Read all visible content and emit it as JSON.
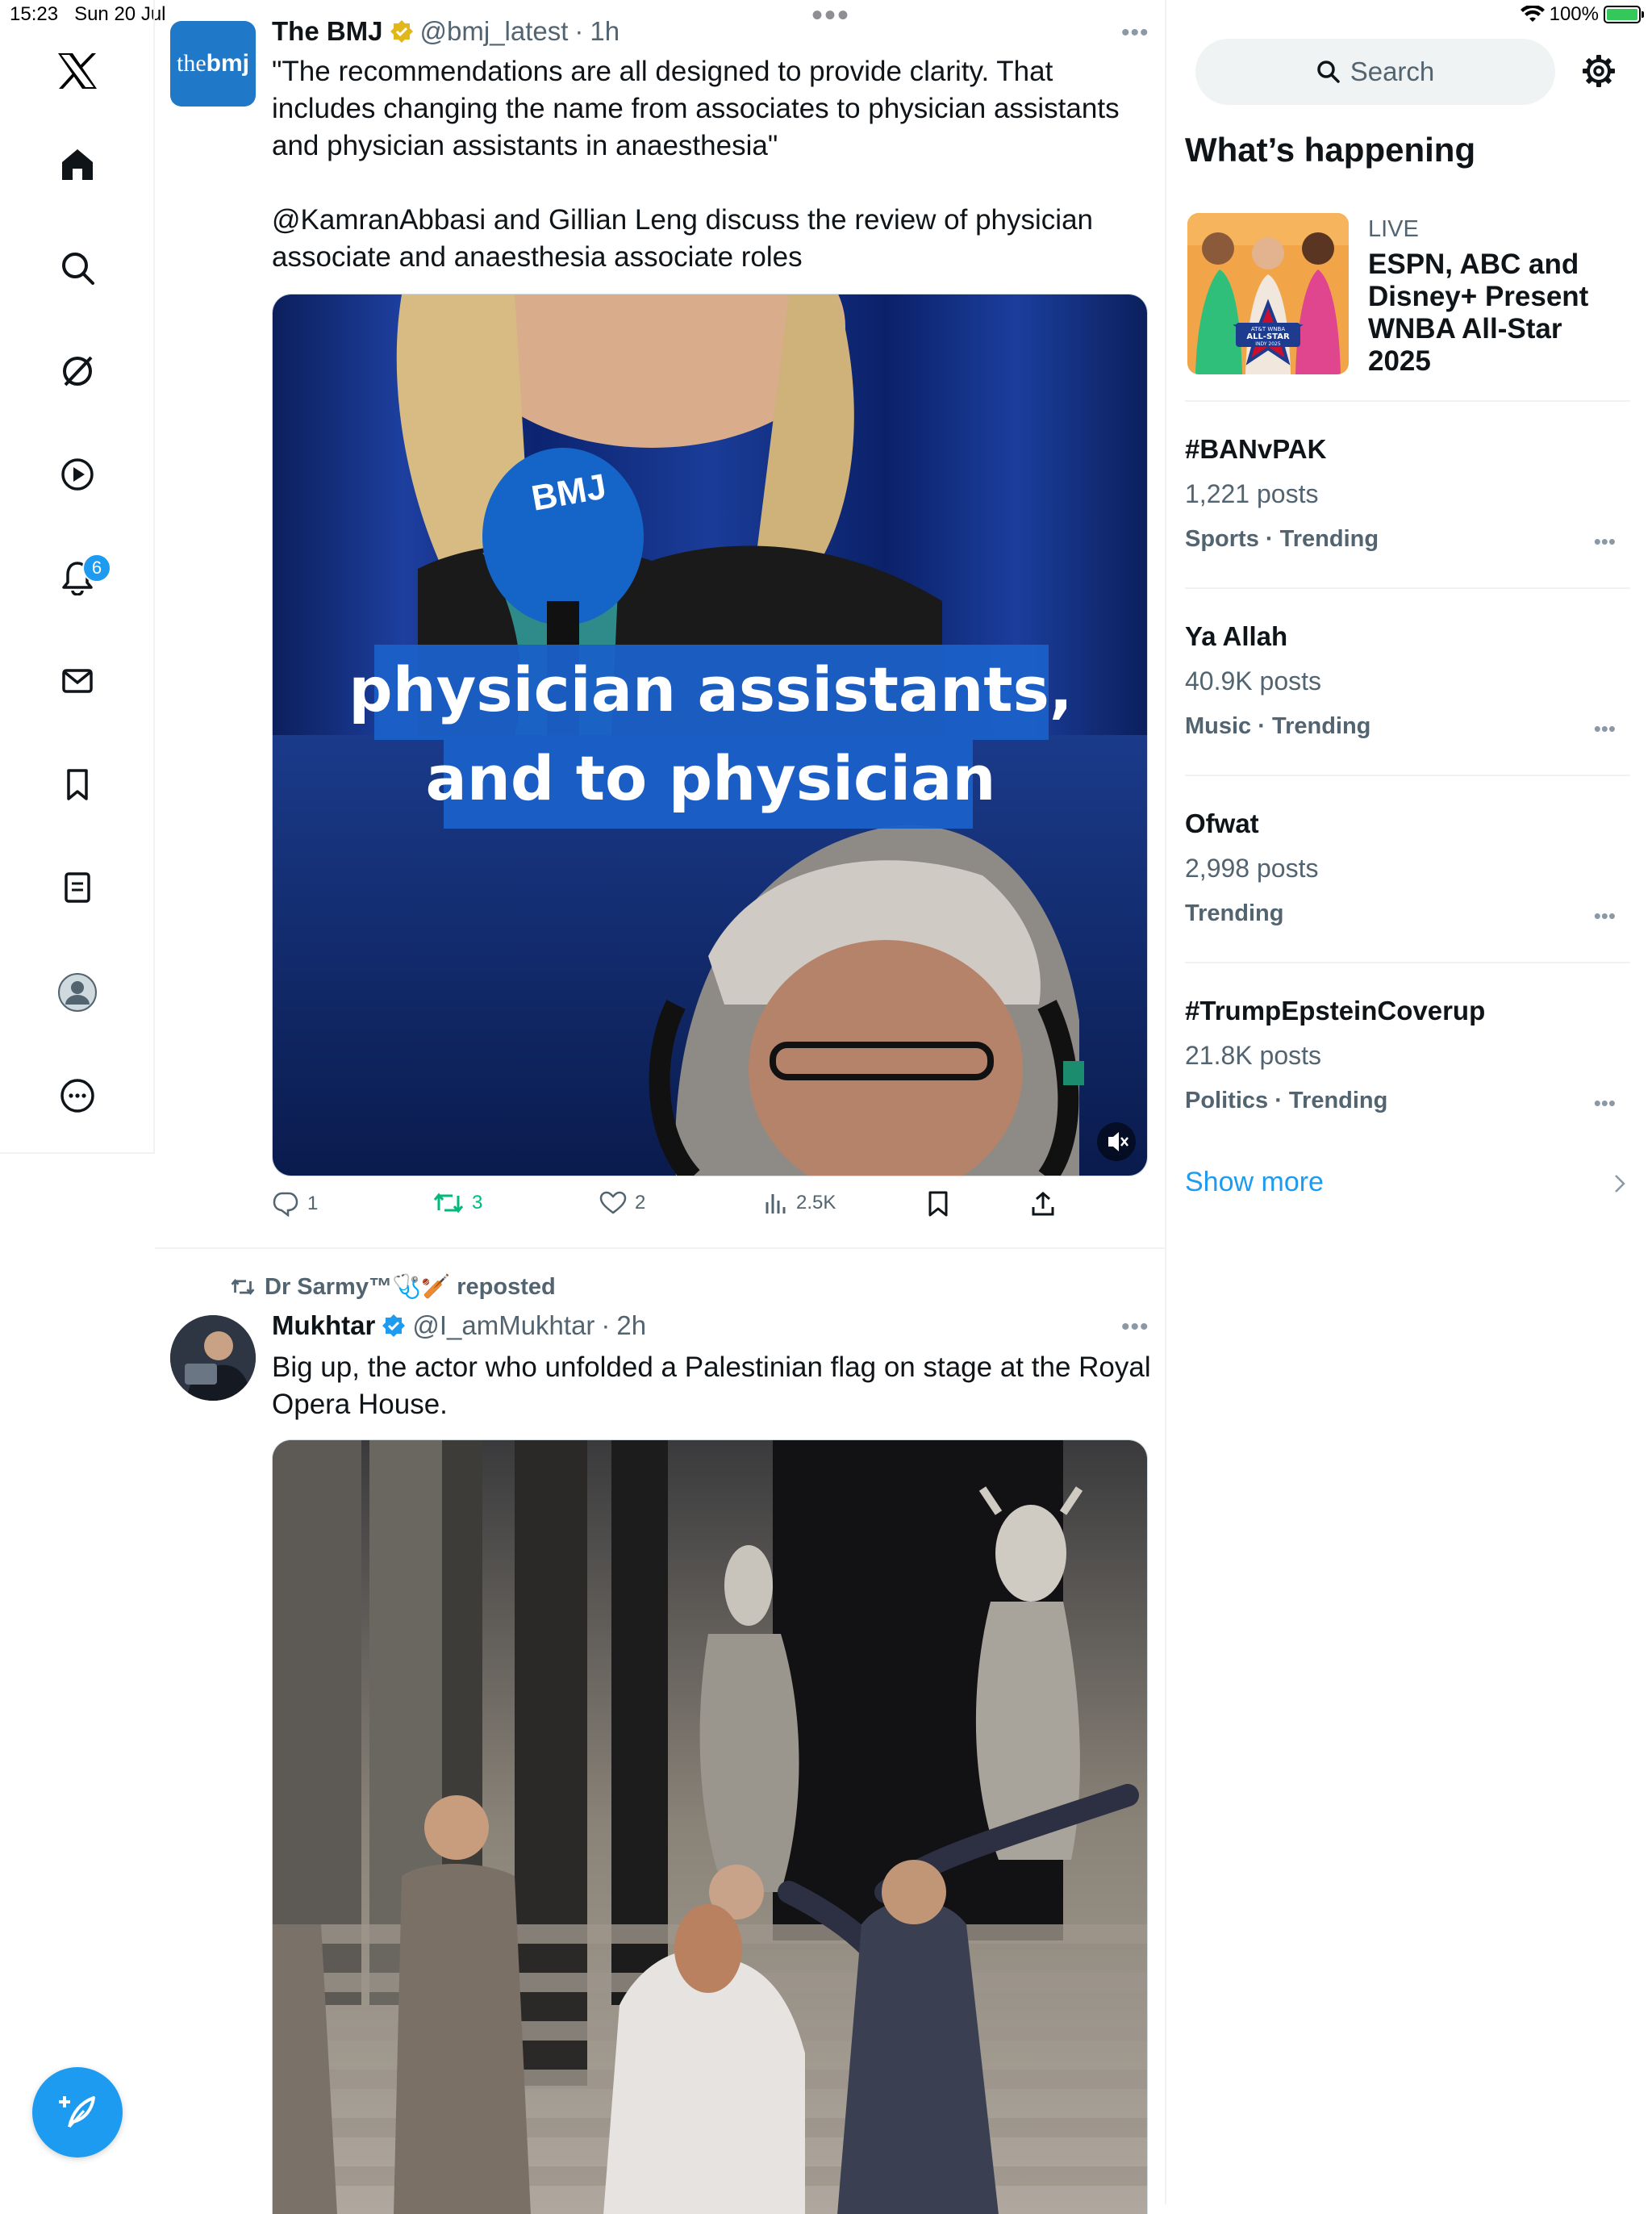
{
  "status_bar": {
    "time": "15:23",
    "date": "Sun 20 Jul",
    "battery": "100%",
    "battery_level": 1.0
  },
  "nav": {
    "items": [
      "x-logo",
      "home",
      "explore",
      "grok",
      "video",
      "notifications",
      "messages",
      "bookmarks",
      "lists",
      "profile",
      "more"
    ],
    "notifications_badge": "6"
  },
  "feed": {
    "tweet1": {
      "name": "The BMJ",
      "handle": "@bmj_latest",
      "time": "1h",
      "avatar_text": "thebmj",
      "text_p1": "\"The recommendations are all designed to provide clarity. That includes changing the name from associates to physician assistants and physician assistants in anaesthesia\"",
      "text_p2": "@KamranAbbasi and Gillian Leng discuss the review of physician associate and anaesthesia associate roles",
      "caption_line1": "physician assistants,",
      "caption_line2": "and to physician",
      "mic_logo": "BMJ",
      "replies": "1",
      "reposts": "3",
      "likes": "2",
      "views": "2.5K"
    },
    "tweet2": {
      "repost_label": "Dr Sarmy™🩺🏏 reposted",
      "name": "Mukhtar",
      "handle": "@I_amMukhtar",
      "time": "2h",
      "text": "Big up, the actor who unfolded a Palestinian flag on stage at the Royal Opera House."
    }
  },
  "sidebar": {
    "search_placeholder": "Search",
    "section_title": "What’s happening",
    "live": {
      "label": "LIVE",
      "title": "ESPN, ABC and Disney+ Present WNBA All-Star 2025",
      "badge_line1": "AT&T WNBA",
      "badge_line2": "ALL-STAR",
      "badge_line3": "INDY 2025"
    },
    "trends": [
      {
        "title": "#BANvPAK",
        "posts": "1,221 posts",
        "category": "Sports · Trending"
      },
      {
        "title": "Ya Allah",
        "posts": "40.9K posts",
        "category": "Music · Trending"
      },
      {
        "title": "Ofwat",
        "posts": "2,998 posts",
        "category": "Trending"
      },
      {
        "title": "#TrumpEpsteinCoverup",
        "posts": "21.8K posts",
        "category": "Politics · Trending"
      }
    ],
    "show_more": "Show more"
  },
  "colors": {
    "accent": "#1d9bf0",
    "repost_green": "#00ba7c",
    "verified_gold": "#e2b719"
  }
}
